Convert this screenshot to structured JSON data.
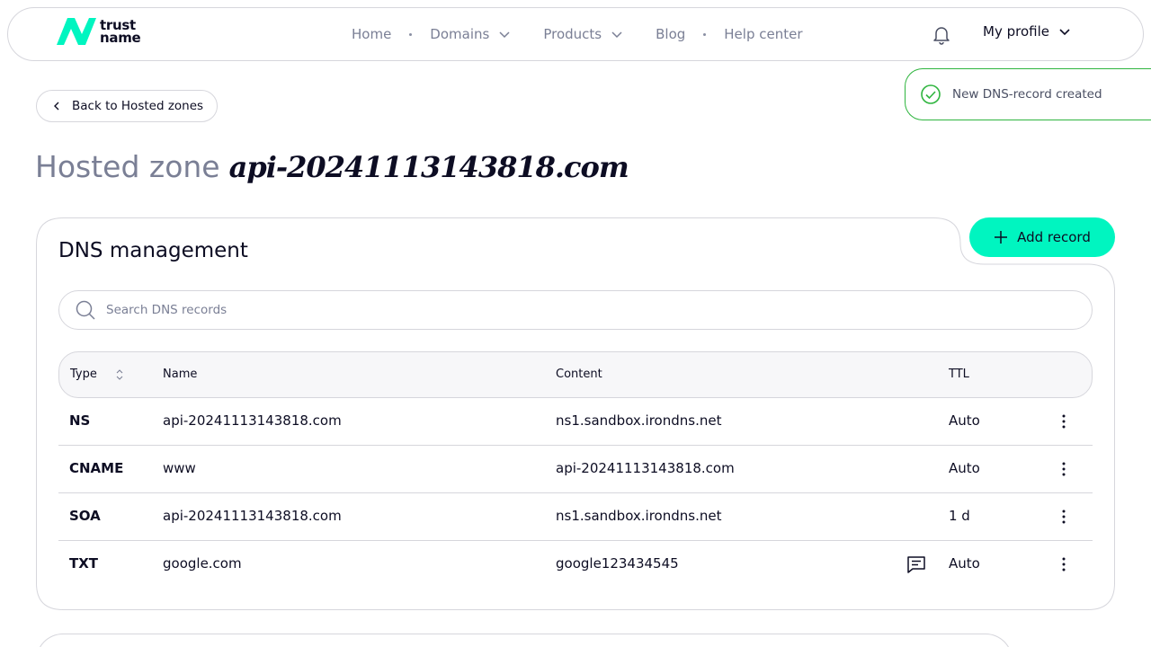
{
  "header": {
    "logo_line1": "trust",
    "logo_line2": "name",
    "nav": [
      {
        "label": "Home"
      },
      {
        "label": "Domains"
      },
      {
        "label": "Products"
      },
      {
        "label": "Blog"
      },
      {
        "label": "Help center"
      }
    ],
    "profile_label": "My profile"
  },
  "toast": {
    "message": "New DNS-record created"
  },
  "back_label": "Back to Hosted zones",
  "title": {
    "prefix": "Hosted zone",
    "zone": "api-20241113143818.com"
  },
  "dns": {
    "heading": "DNS management",
    "add_label": "Add record",
    "search_placeholder": "Search DNS records",
    "columns": {
      "type": "Type",
      "name": "Name",
      "content": "Content",
      "ttl": "TTL"
    },
    "records": [
      {
        "type": "NS",
        "name": "api-20241113143818.com",
        "content": "ns1.sandbox.irondns.net",
        "ttl": "Auto",
        "has_comment": false
      },
      {
        "type": "CNAME",
        "name": "www",
        "content": "api-20241113143818.com",
        "ttl": "Auto",
        "has_comment": false
      },
      {
        "type": "SOA",
        "name": "api-20241113143818.com",
        "content": "ns1.sandbox.irondns.net",
        "ttl": "1 d",
        "has_comment": false
      },
      {
        "type": "TXT",
        "name": "google.com",
        "content": "google123434545",
        "ttl": "Auto",
        "has_comment": true
      }
    ]
  },
  "colors": {
    "accent": "#00f5c0",
    "success": "#2fb53f",
    "text": "#0d0d23",
    "muted": "#7a7f95",
    "border": "#d6d6dc"
  },
  "icons": {
    "bell": "bell-icon",
    "chevron": "chevron-down-icon",
    "back": "chevron-left-icon",
    "toast": "check-circle-icon",
    "add": "plus-icon",
    "search": "search-icon",
    "sort": "sort-icon",
    "comment": "comment-icon",
    "more": "more-vertical-icon"
  }
}
